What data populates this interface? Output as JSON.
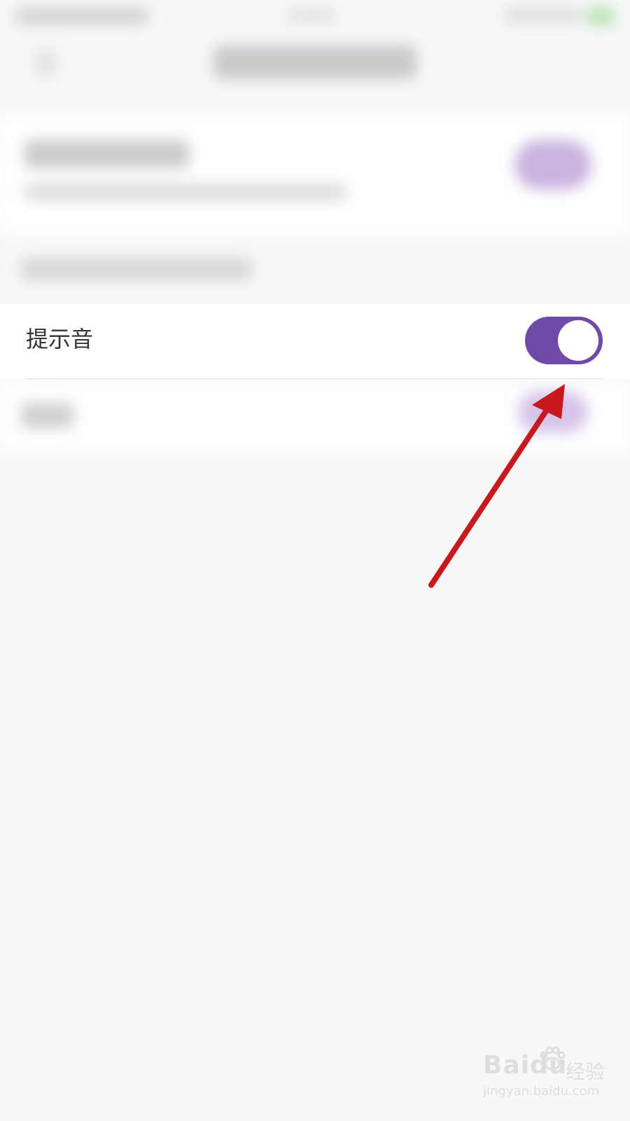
{
  "setting_row": {
    "label": "提示音",
    "toggle_on": true
  },
  "colors": {
    "toggle_accent": "#6f4aa6",
    "arrow": "#c8191c",
    "background": "#f8f8f9"
  },
  "watermark": {
    "logo_text": "Baidu",
    "cn_text": "经验",
    "url": "jingyan.baidu.com"
  }
}
